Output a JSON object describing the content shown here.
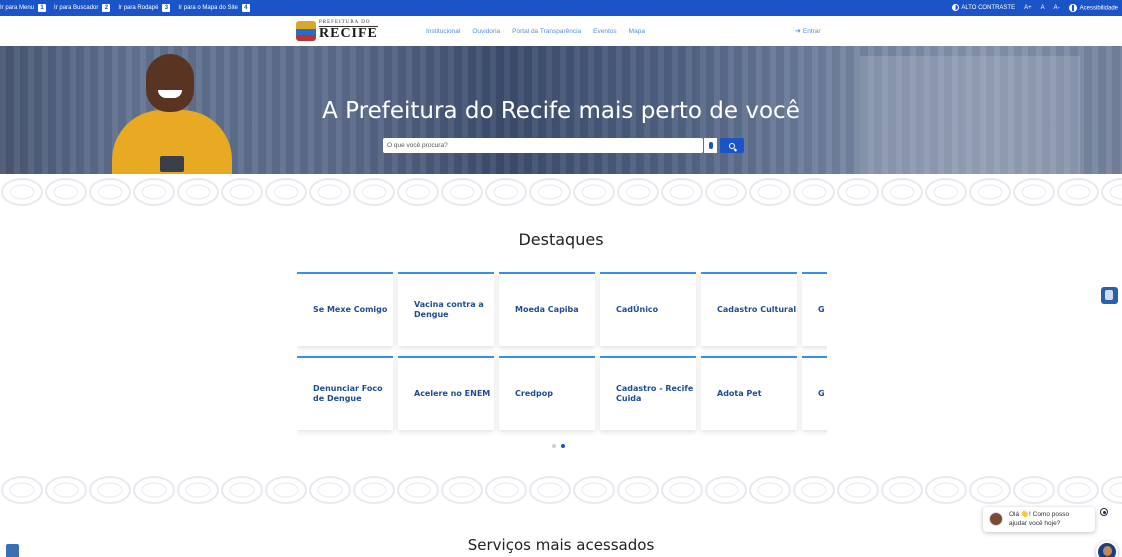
{
  "topbar": {
    "skip_links": [
      {
        "label": "Ir para Menu",
        "key": "1"
      },
      {
        "label": "Ir para Buscador",
        "key": "2"
      },
      {
        "label": "Ir para Rodapé",
        "key": "3"
      },
      {
        "label": "Ir para o Mapa do Site",
        "key": "4"
      }
    ],
    "contrast_label": "ALTO CONTRASTE",
    "font_increase": "A+",
    "font_normal": "A",
    "font_decrease": "A-",
    "accessibility_label": "Acessibilidade"
  },
  "header": {
    "logo_small": "PREFEITURA DO",
    "logo_big": "RECIFE",
    "nav": [
      "Institucional",
      "Ouvidoria",
      "Portal da Transparência",
      "Eventos",
      "Mapa"
    ],
    "login_label": "Entrar"
  },
  "hero": {
    "title": "A Prefeitura do Recife mais perto de você",
    "search_placeholder": "O que você procura?"
  },
  "destaques": {
    "title": "Destaques",
    "row1": [
      "Se Mexe Comigo",
      "Vacina contra a Dengue",
      "Moeda Capiba",
      "CadÚnico",
      "Cadastro Cultural",
      "G"
    ],
    "row2": [
      "Denunciar Foco de Dengue",
      "Acelere no ENEM",
      "Credpop",
      "Cadastro - Recife Cuida",
      "Adota Pet",
      "G"
    ]
  },
  "services": {
    "title": "Serviços mais acessados"
  },
  "chat": {
    "message_line1": "Olá 👋! Como posso",
    "message_line2": "ajudar você hoje?"
  },
  "colors": {
    "primary": "#1b54c7",
    "card_text": "#1f4d8f",
    "card_border": "#3a8ee6"
  }
}
